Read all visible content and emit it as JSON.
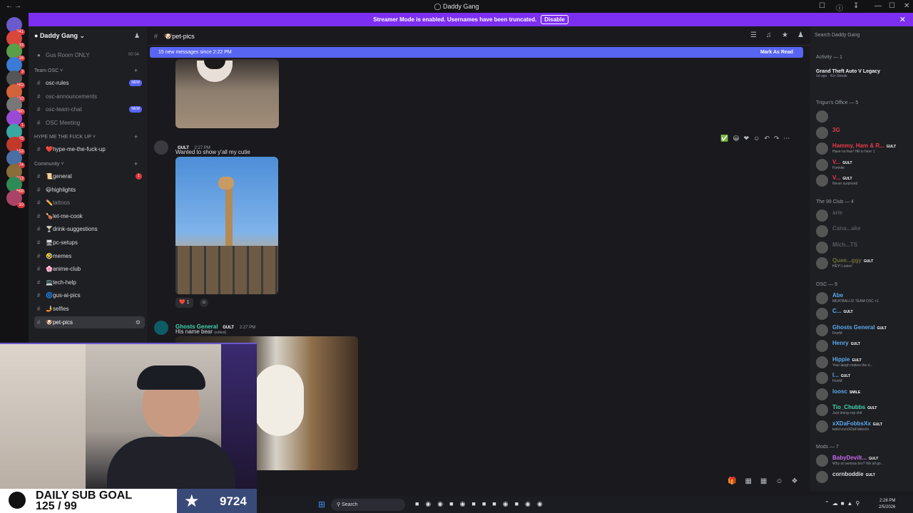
{
  "window": {
    "title": "Daddy Gang"
  },
  "banner": {
    "text": "Streamer Mode is enabled. Usernames have been truncated.",
    "action": "Disable"
  },
  "rail": {
    "badges": [
      "241",
      "33",
      "16",
      "3",
      "HO",
      "110",
      "380",
      "1",
      "25",
      "153",
      "74",
      "313",
      "669",
      "10"
    ]
  },
  "server": {
    "name": "Daddy Gang"
  },
  "channels": {
    "top": [
      {
        "label": "Gus Room ONLY",
        "meta": "00 04"
      }
    ],
    "categories": [
      {
        "label": "Team OSC",
        "items": [
          {
            "label": "osc-rules",
            "badge": "NEW",
            "muted": false
          },
          {
            "label": "osc-announcements",
            "muted": true
          },
          {
            "label": "osc-team-chat",
            "badge": "NEW",
            "muted": true
          },
          {
            "label": "OSC Meeting",
            "muted": true
          }
        ]
      },
      {
        "label": "HYPE ME THE FUCK UP",
        "items": [
          {
            "label": "❤️hype-me-the-fuck-up",
            "muted": false
          }
        ]
      },
      {
        "label": "Community",
        "items": [
          {
            "label": "📜general",
            "badge": "1",
            "muted": false
          },
          {
            "label": "😃highlights",
            "muted": false
          },
          {
            "label": "✏️tattoos",
            "muted": true
          },
          {
            "label": "🍗let-me-cook",
            "muted": false
          },
          {
            "label": "🍸drink-suggestions",
            "muted": false
          },
          {
            "label": "🖥pc-setups",
            "muted": false
          },
          {
            "label": "🤣memes",
            "muted": false
          },
          {
            "label": "🌸anime-club",
            "muted": false
          },
          {
            "label": "💻tech-help",
            "muted": false
          },
          {
            "label": "🌀gus-ai-pics",
            "muted": false
          },
          {
            "label": "🤳selfies",
            "muted": false
          },
          {
            "label": "🐶pet-pics",
            "muted": false,
            "selected": true
          }
        ]
      }
    ]
  },
  "chat": {
    "channel": "🐶pet-pics",
    "new_messages": "15 new messages since 2:22 PM",
    "mark_read": "Mark As Read",
    "messages": [
      {
        "author": "",
        "tag": "GULT",
        "time": "2:27 PM",
        "text": "Wanted to show y'all my cutie",
        "reaction_count": "1"
      },
      {
        "author": "Ghosts General",
        "tag": "GULT",
        "time": "2:27 PM",
        "text": "His name bear",
        "edited": "(edited)"
      }
    ]
  },
  "search": {
    "placeholder": "Search Daddy Gang"
  },
  "members": {
    "activity_header": "Activity — 1",
    "activity": {
      "game": "Grand Theft Auto V Legacy",
      "meta": "1d ago · 41x Streak"
    },
    "groups": [
      {
        "header": "Trigun's Office — 5",
        "members": [
          {
            "name": "",
            "sub": "",
            "color": "#e83a4e"
          },
          {
            "name": "3G",
            "sub": "",
            "color": "#e83a4e"
          },
          {
            "name": "Hammy, Ham & R...",
            "tag": "GULT",
            "sub": "Have no fear! HR is here :)",
            "color": "#e83a4e"
          },
          {
            "name": "V...",
            "tag": "GULT",
            "sub": "Fortnite",
            "color": "#e83a4e"
          },
          {
            "name": "V...",
            "tag": "GULT",
            "sub": "Never surprised",
            "color": "#e83a4e"
          }
        ]
      },
      {
        "header": "The 99 Club — 4",
        "members": [
          {
            "name": "arie",
            "sub": "",
            "color": "#5a5560"
          },
          {
            "name": "Cana...ake",
            "sub": "",
            "color": "#5a5560"
          },
          {
            "name": "Mich...TS",
            "sub": "",
            "color": "#5a5560"
          },
          {
            "name": "Quee...ggy",
            "tag": "GULT",
            "sub": "HEY! Listen!",
            "color": "#6b6c3a"
          }
        ]
      },
      {
        "header": "OSC — 9",
        "members": [
          {
            "name": "Abe",
            "sub": "MEATBALLS! TEAM OSC +1",
            "color": "#5aa9f0"
          },
          {
            "name": "C...",
            "tag": "GULT",
            "sub": "",
            "color": "#5aa9f0"
          },
          {
            "name": "Ghosts General",
            "tag": "GULT",
            "sub": "FiveM",
            "color": "#5aa9f0"
          },
          {
            "name": "Henry",
            "tag": "GULT",
            "sub": "",
            "color": "#5aa9f0"
          },
          {
            "name": "Hippie",
            "tag": "GULT",
            "sub": "Your laugh makes the d...",
            "color": "#5aa9f0"
          },
          {
            "name": "I...",
            "tag": "GULT",
            "sub": "FiveM",
            "color": "#5aa9f0"
          },
          {
            "name": "loosc",
            "tag": "SMILE",
            "sub": "",
            "color": "#5aa9f0"
          },
          {
            "name": "Tio_Chubbs",
            "tag": "GULT",
            "sub": "Just doing cop shit",
            "color": "#43d3b0"
          },
          {
            "name": "xXDaFobbsXx",
            "tag": "GULT",
            "sub": "twitch.tv/xXDaFobbsXx",
            "color": "#5aa9f0"
          }
        ]
      },
      {
        "header": "Mods — 7",
        "members": [
          {
            "name": "BabyDevilt...",
            "tag": "GULT",
            "sub": "Why so serious bro? We all go...",
            "color": "#c86bf0"
          },
          {
            "name": "cornboddie",
            "tag": "GULT",
            "sub": "",
            "color": "#dbdee1"
          }
        ]
      }
    ]
  },
  "overlay": {
    "goal_title": "DAILY SUB GOAL",
    "goal_progress": "125 / 99",
    "sub_count": "9724"
  },
  "taskbar": {
    "search": "Search",
    "time": "2:28 PM",
    "date": "2/5/2026"
  }
}
